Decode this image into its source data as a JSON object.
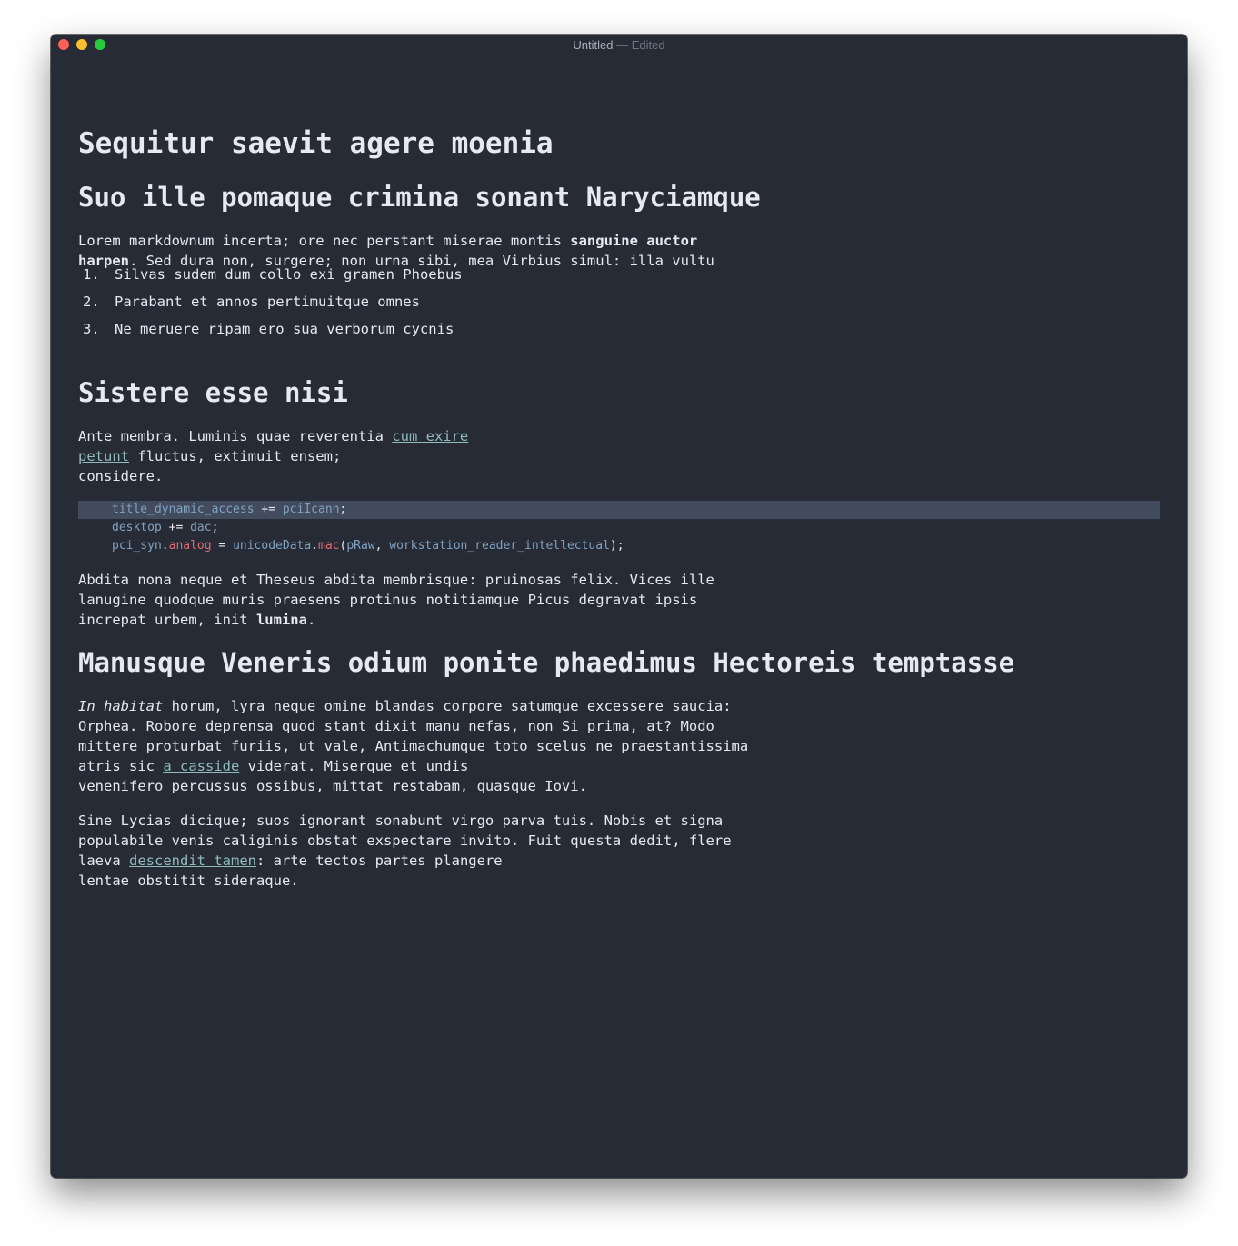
{
  "window": {
    "title": "Untitled",
    "title_separator": "—",
    "title_status": "Edited"
  },
  "doc": {
    "h1": "Sequitur saevit agere moenia",
    "section1": {
      "heading": "Suo ille pomaque crimina sonant Naryciamque",
      "p1_a": "Lorem markdownum incerta; ore nec perstant miserae montis ",
      "p1_b": "sanguine auctor",
      "p1_c": "harpen",
      "p1_d": ". Sed dura non, surgere; non urna sibi, mea Virbius simul: illa vultu",
      "list": [
        {
          "num": "1.",
          "text": "Silvas sudem dum collo exi gramen Phoebus"
        },
        {
          "num": "2.",
          "text": "Parabant et annos pertimuitque omnes"
        },
        {
          "num": "3.",
          "text": "Ne meruere ripam ero sua verborum cycnis"
        }
      ]
    },
    "section2": {
      "heading": "Sistere esse nisi",
      "p1_a": "Ante membra. Luminis quae reverentia ",
      "p1_link1": "cum exire",
      "p1_link2": "petunt",
      "p1_b": " fluctus, extimuit ensem;",
      "p1_c": "considere.",
      "code": {
        "line1": {
          "var": "title_dynamic_access",
          "op": " += ",
          "val": "pciIcann",
          "end": ";"
        },
        "line2": {
          "var": "desktop",
          "op": " += ",
          "val": "dac",
          "end": ";"
        },
        "line3": {
          "obj": "pci_syn",
          "dot": ".",
          "prop": "analog",
          "op": " = ",
          "fn_obj": "unicodeData",
          "dot2": ".",
          "fn": "mac",
          "open": "(",
          "arg1": "pRaw",
          "comma": ", ",
          "arg2": "workstation_reader_intellectual",
          "close": ");"
        }
      },
      "p2_a": "Abdita nona neque et Theseus abdita membrisque: pruinosas felix. Vices ille",
      "p2_b": "lanugine quodque muris praesens protinus notitiamque Picus degravat ipsis",
      "p2_c": "increpat urbem, init ",
      "p2_bold": "lumina",
      "p2_d": "."
    },
    "section3": {
      "heading": "Manusque Veneris odium ponite phaedimus Hectoreis temptasse",
      "p1_italic": "In habitat",
      "p1_a": " horum, lyra neque omine blandas corpore satumque excessere saucia:",
      "p1_b": "Orphea. Robore deprensa quod stant dixit manu nefas, non Si prima, at? Modo",
      "p1_c": "mittere proturbat furiis, ut vale, Antimachumque toto scelus ne praestantissima",
      "p1_d": "atris sic ",
      "p1_link": "a casside",
      "p1_e": " viderat. Miserque et undis",
      "p1_f": "venenifero percussus ossibus, mittat restabam, quasque Iovi.",
      "p2_a": "Sine Lycias dicique; suos ignorant sonabunt virgo parva tuis. Nobis et signa",
      "p2_b": "populabile venis caliginis obstat exspectare invito. Fuit questa dedit, flere",
      "p2_c": "laeva ",
      "p2_link": "descendit tamen",
      "p2_d": ": arte tectos partes plangere",
      "p2_e": "lentae obstitit sideraque."
    }
  },
  "colors": {
    "background": "#262b36",
    "text": "#e6e9ef",
    "link": "#8fbcbb",
    "code_variable": "#81a1c1",
    "code_property": "#e06c75",
    "code_highlight": "#434c5e"
  }
}
